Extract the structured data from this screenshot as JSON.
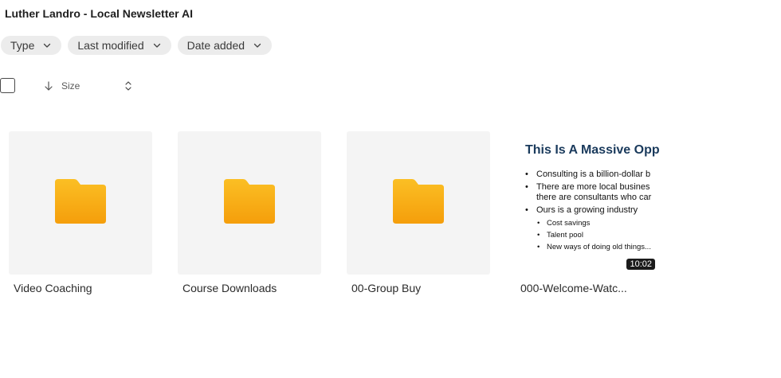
{
  "header": {
    "title": "Luther Landro - Local Newsletter AI"
  },
  "filters": [
    {
      "label": "Type",
      "icon": "chevron-down-icon"
    },
    {
      "label": "Last modified",
      "icon": "chevron-down-icon"
    },
    {
      "label": "Date added",
      "icon": "chevron-down-icon"
    }
  ],
  "sort": {
    "label": "Size",
    "direction": "descending",
    "direction_icon": "arrow-down-icon",
    "toggle_icon": "sort-toggle-icon"
  },
  "items": [
    {
      "name": "Video Coaching",
      "kind": "folder",
      "icon": "folder-icon"
    },
    {
      "name": "Course Downloads",
      "kind": "folder",
      "icon": "folder-icon"
    },
    {
      "name": "00-Group Buy",
      "kind": "folder",
      "icon": "folder-icon"
    },
    {
      "name": "000-Welcome-Watc...",
      "kind": "video",
      "duration": "10:02",
      "thumbnail": {
        "title": "This Is A Massive Opp",
        "bullets": [
          "Consulting is a billion-dollar b",
          "There are more local busines",
          "there are consultants who car",
          "Ours is a growing industry"
        ],
        "sub_bullets": [
          "Cost savings",
          "Talent pool",
          "New ways of doing old things..."
        ]
      }
    }
  ],
  "colors": {
    "folder_top": "#fbbf24",
    "folder_bottom": "#f59e0b",
    "chip_bg": "#ececec",
    "tile_bg": "#f4f4f4",
    "slide_title": "#1a3a5c"
  }
}
